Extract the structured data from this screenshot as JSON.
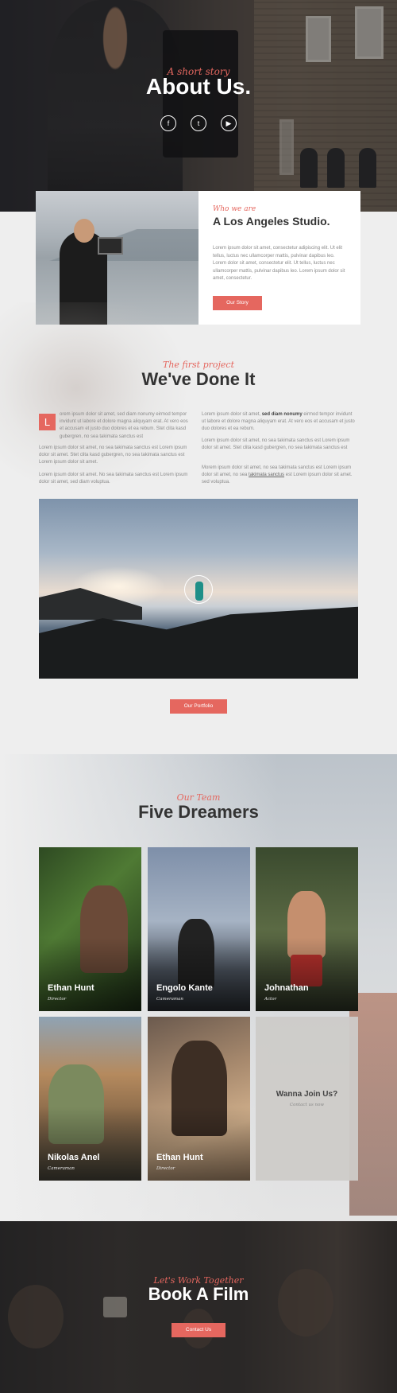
{
  "hero": {
    "kicker": "A short story",
    "title": "About Us.",
    "social": [
      {
        "icon": "facebook-icon",
        "glyph": "f"
      },
      {
        "icon": "twitter-icon",
        "glyph": "t"
      },
      {
        "icon": "youtube-icon",
        "glyph": "▶"
      }
    ]
  },
  "studio": {
    "kicker": "Who we are",
    "title": "A Los Angeles Studio.",
    "body": "Lorem ipsum dolor sit amet, consectetur adipiscing elit. Ut elit tellus, luctus nec ullamcorper mattis, pulvinar dapibus leo. Lorem dolor sit amet, consectetur elit. Ut tellus, luctus nec ullamcorper mattis, pulvinar dapibus leo. Lorem ipsum dolor sit amet, consectetur.",
    "button": "Our Story"
  },
  "project": {
    "kicker": "The first project",
    "title": "We've Done It",
    "dropcap": "L",
    "left_col": [
      "orem ipsum dolor sit amet, sed diam nonumy eirmod tempor invidunt ut labore et dolore magna aliquyam erat. At vero eos et accusam et justo duo dolores et ea rebum. Stet clita kasd gubergren, no sea takimata sanctus est",
      "Lorem ipsum dolor sit amet, no sea takimata sanctus est Lorem ipsum dolor sit amet. Stet clita kasd gubergren, no sea takimata sanctus est Lorem ipsum dolor sit amet.",
      "Lorem ipsum dolor sit amet. No sea takimata sanctus est Lorem ipsum dolor sit amet, sed diam voluptua."
    ],
    "right_col": {
      "p1_a": "Lorem ipsum dolor sit amet, ",
      "p1_bold": "sed diam nonumy",
      "p1_b": " eirmod tempor invidunt ut labore et dolore magna aliquyam erat. At vero eos et accusam et justo duo dolores et ea rebum.",
      "p2": "Lorem ipsum dolor sit amet, no sea takimata sanctus est Lorem ipsum dolor sit amet. Stet clita kasd gubergren, no sea takimata sanctus est",
      "p3_a": "Morem ipsum dolor sit amet, no sea takimata sanctus est Lorem ipsum dolor sit amet, no sea ",
      "p3_link": "takimata sanctus",
      "p3_b": " est Lorem ipsum dolor sit amet. sed voluptua."
    },
    "button": "Our Portfolio"
  },
  "team": {
    "kicker": "Our Team",
    "title": "Five Dreamers",
    "members": [
      {
        "name": "Ethan Hunt",
        "role": "Director"
      },
      {
        "name": "Engolo Kante",
        "role": "Cameraman"
      },
      {
        "name": "Johnathan",
        "role": "Actor"
      },
      {
        "name": "Nikolas Anel",
        "role": "Cameraman"
      },
      {
        "name": "Ethan Hunt",
        "role": "Director"
      }
    ],
    "join": {
      "title": "Wanna Join Us?",
      "subtitle": "Contact us now"
    }
  },
  "footer": {
    "kicker": "Let's Work Together",
    "title": "Book A Film",
    "button": "Contact Us"
  },
  "colors": {
    "accent": "#e5675f",
    "text_dark": "#333333",
    "text_muted": "#8a8a8a",
    "page_bg": "#eeeeee"
  }
}
